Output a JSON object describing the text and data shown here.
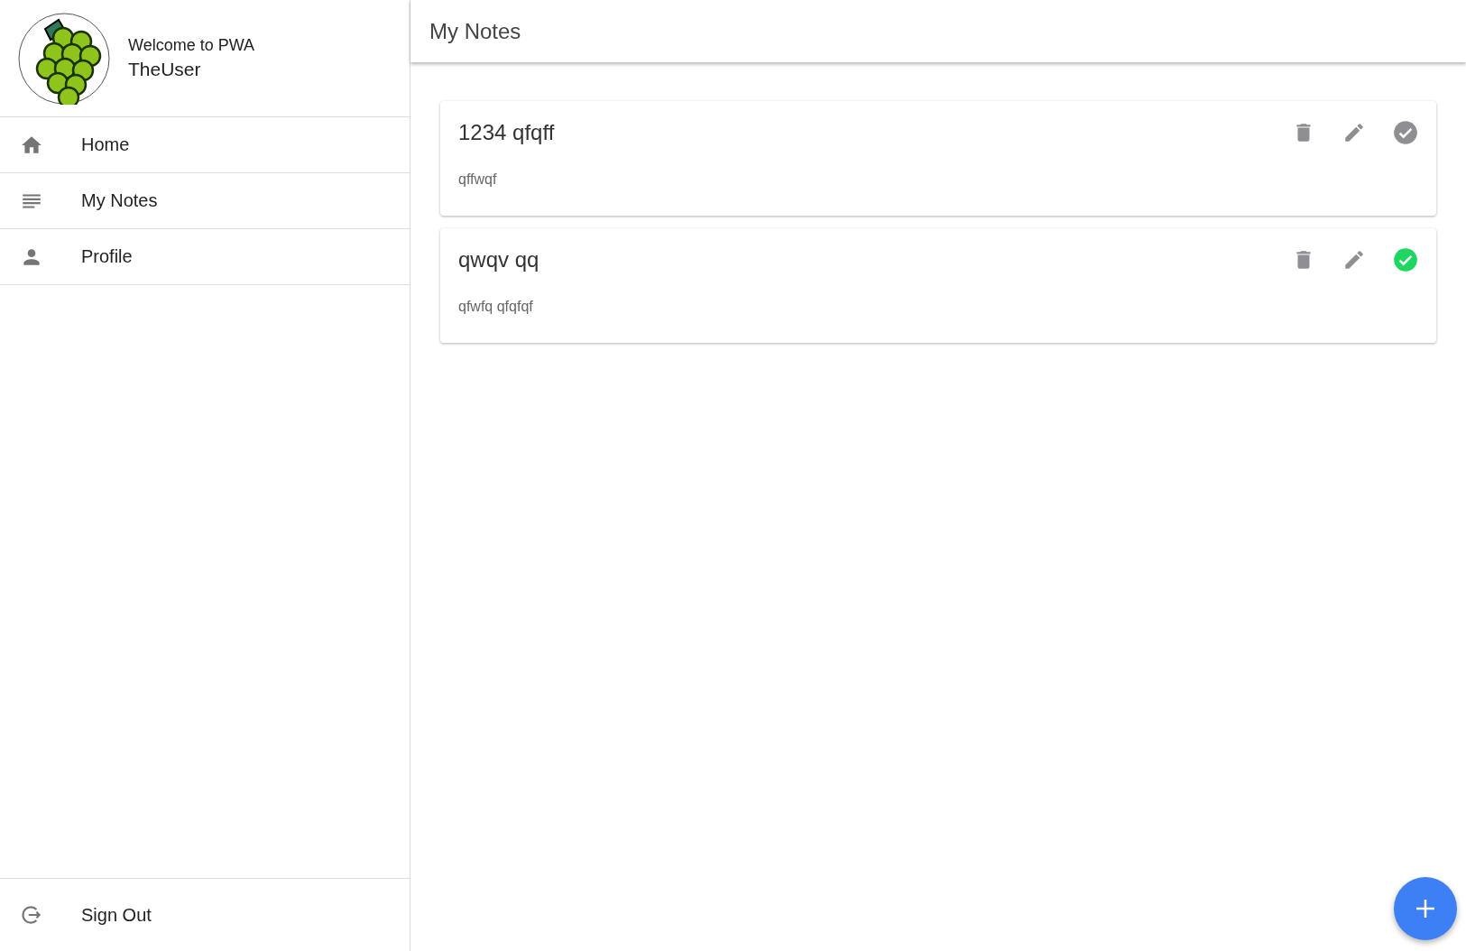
{
  "sidebar": {
    "welcome": "Welcome to PWA",
    "user": "TheUser",
    "items": [
      {
        "kind": "home",
        "label": "Home"
      },
      {
        "kind": "notes",
        "label": "My Notes"
      },
      {
        "kind": "profile",
        "label": "Profile"
      }
    ],
    "sign_out": "Sign Out"
  },
  "top_bar": {
    "title": "My Notes"
  },
  "notes": [
    {
      "title": "1234 qfqff",
      "body": "qffwqf",
      "done": false
    },
    {
      "title": "qwqv qq",
      "body": "qfwfq qfqfqf",
      "done": true
    }
  ]
}
